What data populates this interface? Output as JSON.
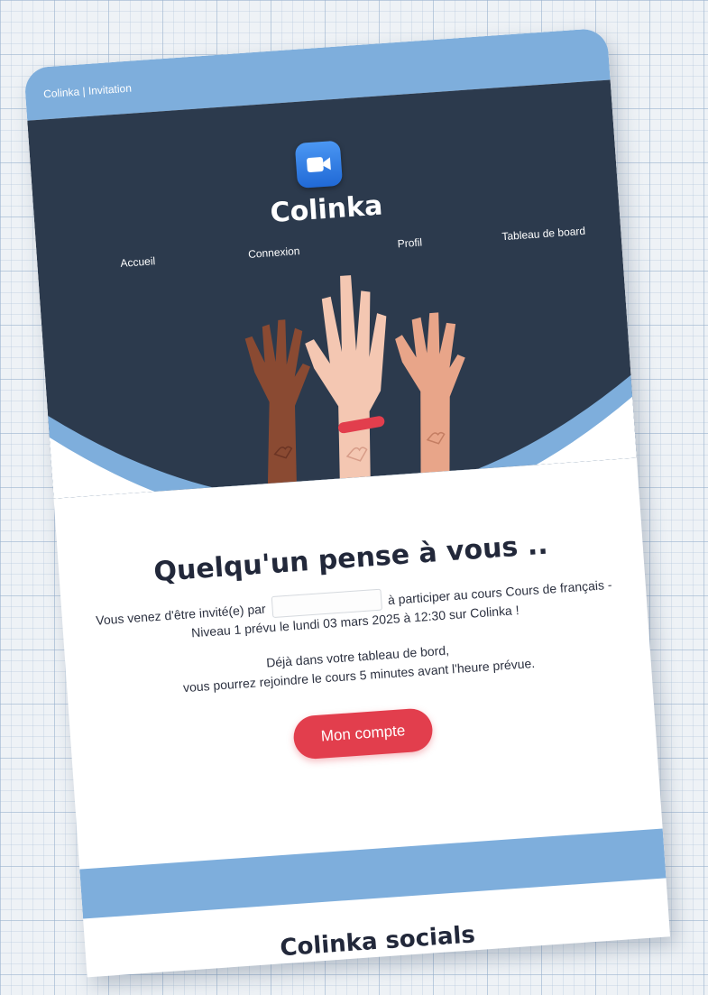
{
  "topbar": {
    "label": "Colinka | Invitation"
  },
  "header": {
    "brand": "Colinka",
    "nav": [
      {
        "label": "Accueil"
      },
      {
        "label": "Connexion"
      },
      {
        "label": "Profil"
      },
      {
        "label": "Tableau de board"
      }
    ]
  },
  "main": {
    "headline": "Quelqu'un pense à vous ..",
    "invite_before": "Vous venez d'être invité(e) par",
    "invite_after": "à participer au cours Cours de français - Niveau 1 prévu le lundi 03 mars 2025 à 12:30 sur Colinka !",
    "note_line1": "Déjà dans votre tableau de bord,",
    "note_line2": "vous pourrez rejoindre le cours 5 minutes avant l'heure prévue.",
    "cta_label": "Mon compte"
  },
  "footer": {
    "socials_title": "Colinka socials"
  },
  "colors": {
    "accent_blue": "#7eaedc",
    "hero_dark": "#2c3a4d",
    "cta_red": "#e23e4d",
    "logo_blue": "#2d7ff0"
  },
  "icons": {
    "logo": "video-camera-icon",
    "illustration": "raised-hands-illustration"
  }
}
